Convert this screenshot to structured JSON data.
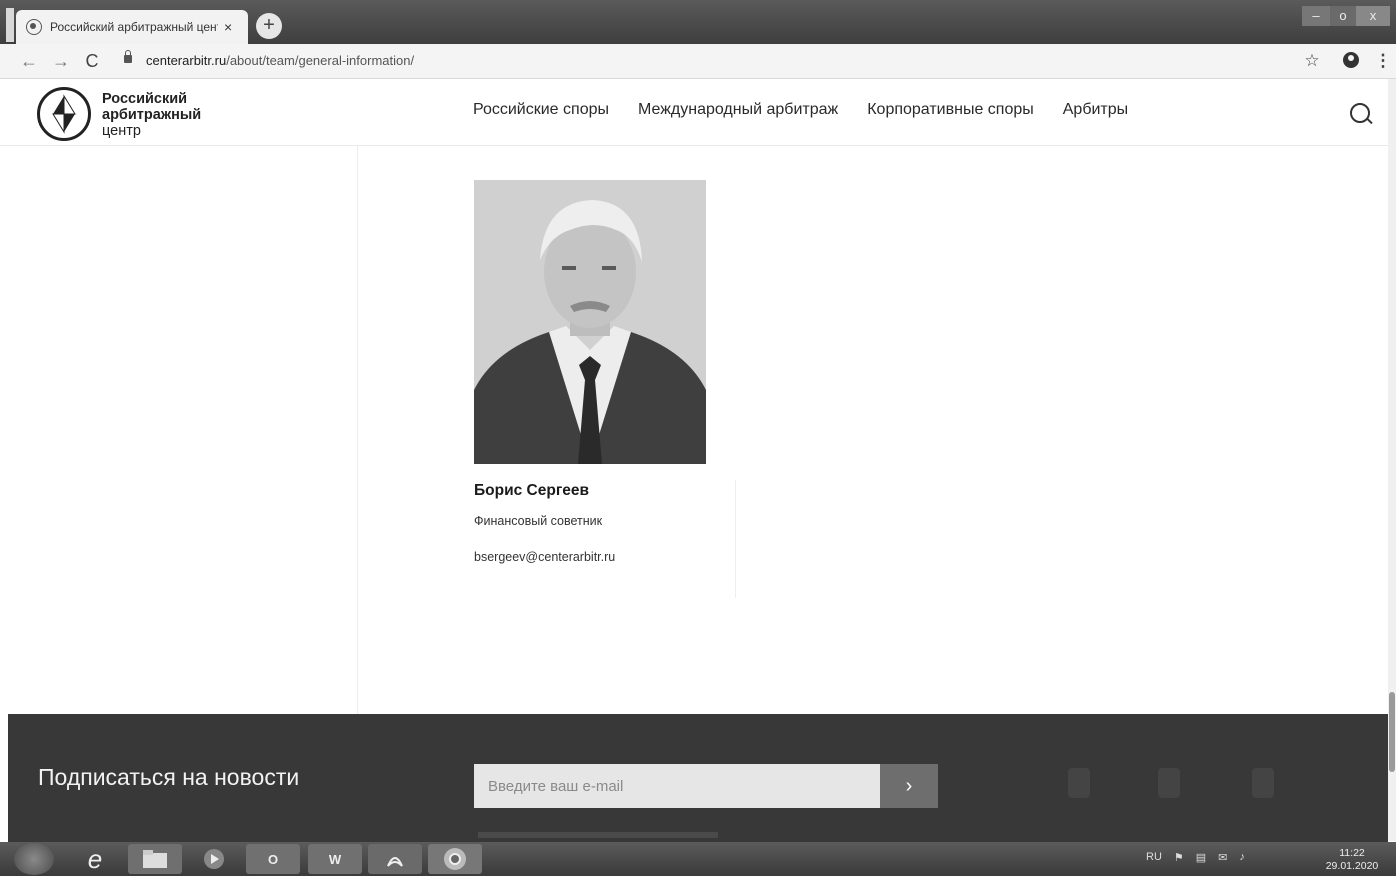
{
  "browser": {
    "tab_title": "Российский арбитражный цент",
    "tab_close": "×",
    "new_tab": "+",
    "url_host": "centerarbitr.ru",
    "url_path": "/about/team/general-information/",
    "icons": {
      "back": "←",
      "forward": "→",
      "reload": "C",
      "star": "☆",
      "menu": "⋮"
    },
    "window_controls": {
      "minimize": "–",
      "maximize": "o",
      "close": "x"
    }
  },
  "site": {
    "logo": {
      "line1": "Российский",
      "line2": "арбитражный",
      "line3": "центр"
    },
    "nav": [
      {
        "label": "Российские споры"
      },
      {
        "label": "Международный арбитраж"
      },
      {
        "label": "Корпоративные споры"
      },
      {
        "label": "Арбитры"
      }
    ]
  },
  "person": {
    "name": "Борис Сергеев",
    "role": "Финансовый советник",
    "email": "bsergeev@centerarbitr.ru"
  },
  "footer": {
    "subscribe_title": "Подписаться на новости",
    "email_placeholder": "Введите ваш e-mail",
    "submit": "›"
  },
  "taskbar": {
    "ie_glyph": "e",
    "outlook_label": "O",
    "word_label": "W",
    "tray_lang": "RU",
    "time": "11:22",
    "date": "29.01.2020"
  }
}
